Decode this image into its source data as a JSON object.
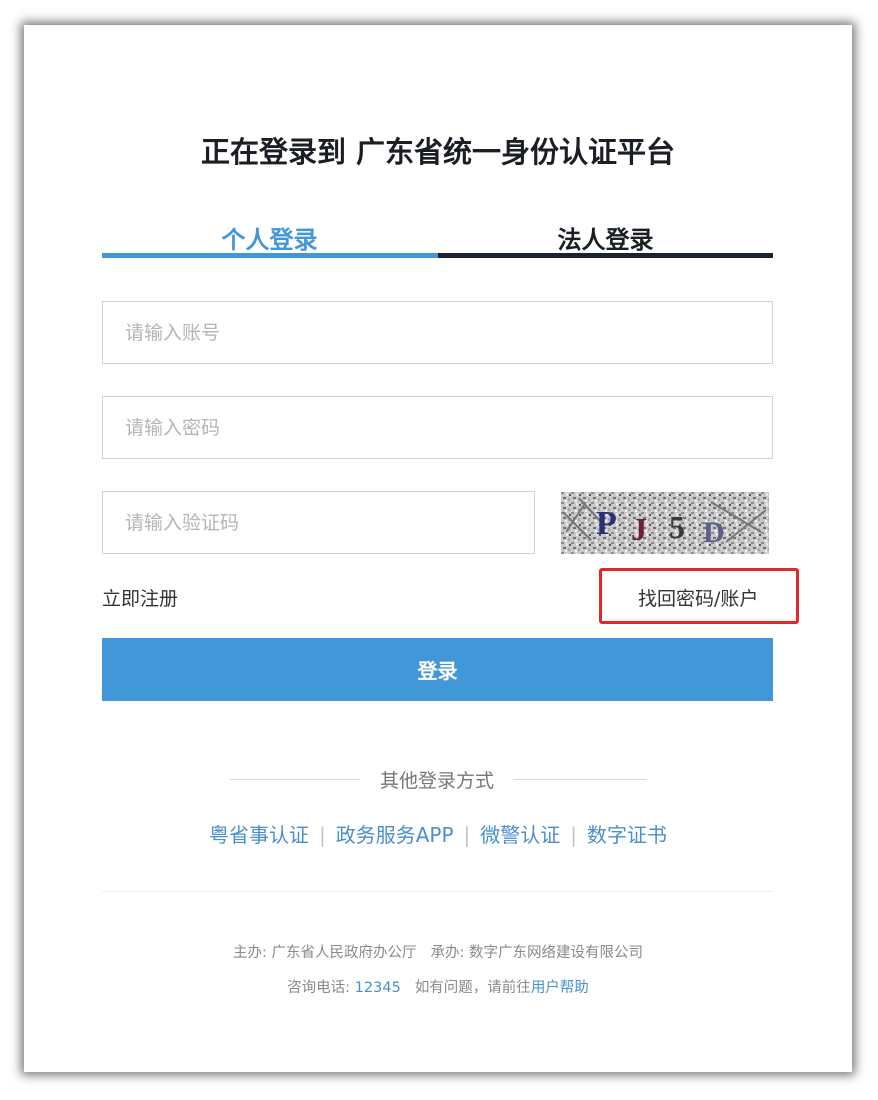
{
  "title": "正在登录到 广东省统一身份认证平台",
  "tabs": [
    {
      "label": "个人登录",
      "active": true
    },
    {
      "label": "法人登录",
      "active": false
    }
  ],
  "form": {
    "account_placeholder": "请输入账号",
    "account_value": "",
    "password_placeholder": "请输入密码",
    "password_value": "",
    "captcha_placeholder": "请输入验证码",
    "captcha_value": "",
    "captcha_image_text": "PJ5D"
  },
  "links": {
    "register": "立即注册",
    "recover": "找回密码/账户"
  },
  "login_button": "登录",
  "other_login": {
    "title": "其他登录方式",
    "methods": [
      "粤省事认证",
      "政务服务APP",
      "微警认证",
      "数字证书"
    ],
    "separator": "|"
  },
  "footer": {
    "sponsor_label": "主办:",
    "sponsor": "广东省人民政府办公厅",
    "undertaker_label": "承办:",
    "undertaker": "数字广东网络建设有限公司",
    "hotline_label": "咨询电话:",
    "hotline": "12345",
    "help_prefix": "如有问题，请前往",
    "help_link": "用户帮助"
  },
  "colors": {
    "accent": "#4297d9",
    "dark": "#1b1e24",
    "link": "#4a8fcc",
    "highlight": "#e02a2a"
  }
}
